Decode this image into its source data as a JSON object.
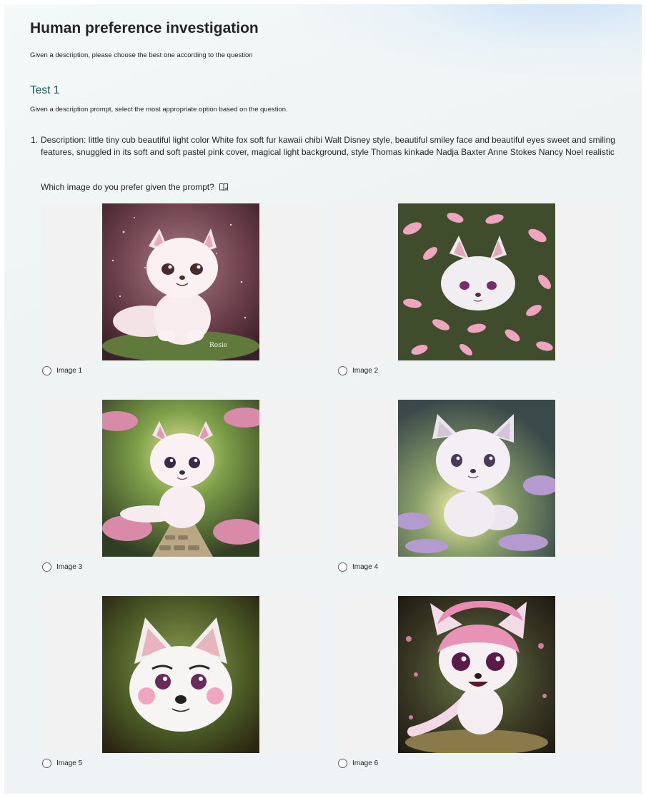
{
  "form": {
    "title": "Human preference investigation",
    "subtitle": "Given a description, please choose the best one according to the question"
  },
  "section": {
    "title": "Test 1",
    "description": "Given a description prompt, select the most appropriate option based on the question."
  },
  "question": {
    "number": "1.",
    "description": "Description: little tiny cub beautiful light color White fox soft fur kawaii chibi Walt Disney style, beautiful smiley face and beautiful eyes sweet and smiling features, snuggled in its soft and soft pastel pink cover, magical light background, style Thomas kinkade Nadja Baxter Anne Stokes Nancy Noel realistic",
    "prompt": "Which image do you prefer given the prompt?",
    "reader_icon": "immersive-reader-icon",
    "options": [
      {
        "label": "Image 1"
      },
      {
        "label": "Image 2"
      },
      {
        "label": "Image 3"
      },
      {
        "label": "Image 4"
      },
      {
        "label": "Image 5"
      },
      {
        "label": "Image 6"
      }
    ]
  },
  "colors": {
    "section_title": "#0f5b58",
    "image_panel": "#f3f2f3",
    "radio_border": "#5c5c5c"
  }
}
